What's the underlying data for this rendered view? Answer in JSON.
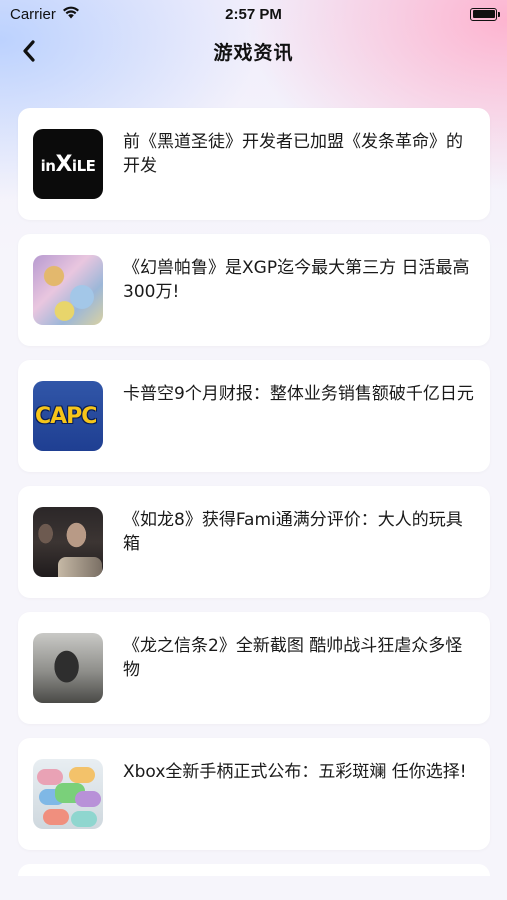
{
  "status_bar": {
    "carrier": "Carrier",
    "time": "2:57 PM"
  },
  "nav": {
    "title": "游戏资讯"
  },
  "news": [
    {
      "title": "前《黑道圣徒》开发者已加盟《发条革命》的开发",
      "thumb": "inXile"
    },
    {
      "title": "《幻兽帕鲁》是XGP迄今最大第三方 日活最高300万!"
    },
    {
      "title": "卡普空9个月财报：整体业务销售额破千亿日元",
      "thumb": "CAPCOM"
    },
    {
      "title": "《如龙8》获得Fami通满分评价：大人的玩具箱"
    },
    {
      "title": "《龙之信条2》全新截图 酷帅战斗狂虐众多怪物"
    },
    {
      "title": "Xbox全新手柄正式公布：五彩斑斓 任你选择!"
    }
  ],
  "colors": {
    "background": "#f6f5fb",
    "card": "#ffffff",
    "capcom_blue": "#1f3f92",
    "capcom_yellow": "#f6c51a"
  }
}
